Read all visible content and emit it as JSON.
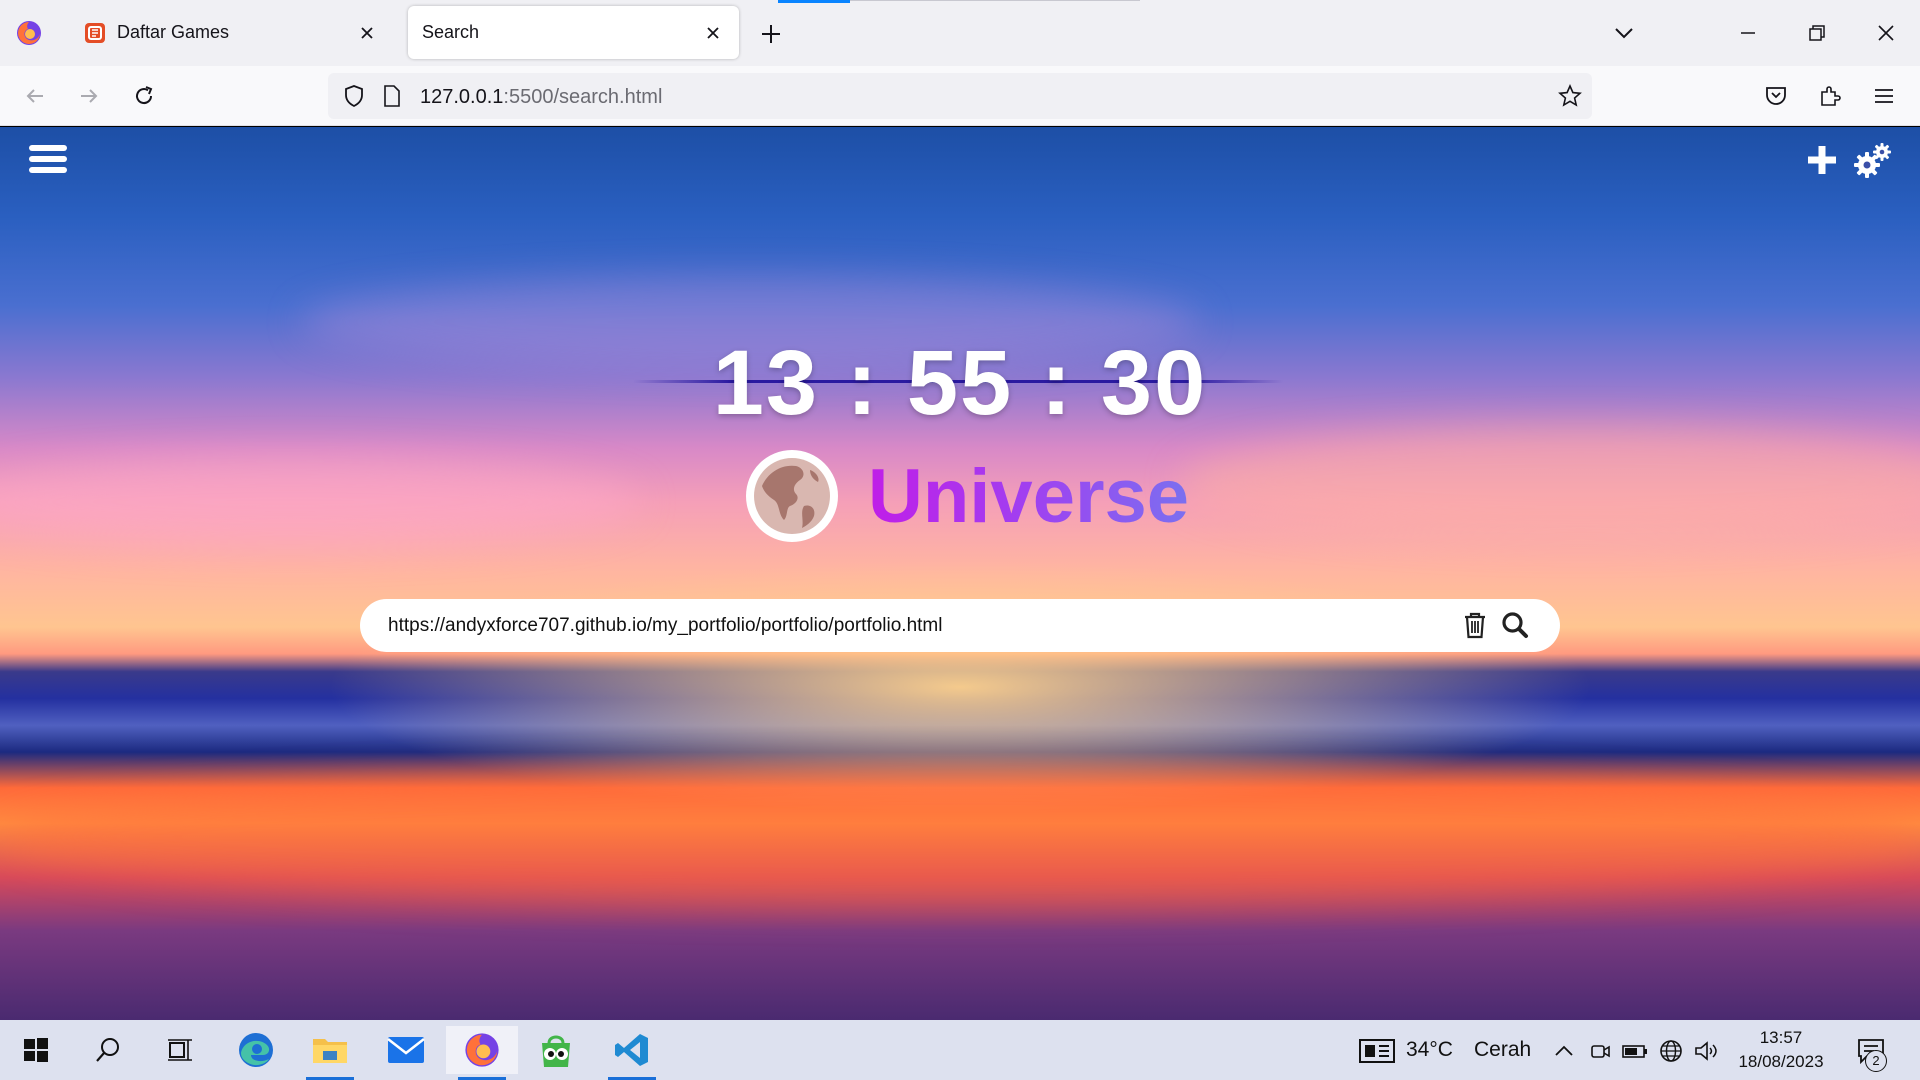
{
  "browser": {
    "tabs": [
      {
        "label": "Daftar Games",
        "favicon": "html5-icon",
        "active": false
      },
      {
        "label": "Search",
        "favicon": "",
        "active": true
      }
    ],
    "url": {
      "host": "127.0.0.1",
      "path": ":5500/search.html"
    }
  },
  "page": {
    "clock": "13 : 55 : 30",
    "brand": "Universe",
    "search_value": "https://andyxforce707.github.io/my_portfolio/portfolio/portfolio.html"
  },
  "taskbar": {
    "apps": [
      "start-icon",
      "search-icon",
      "task-view-icon",
      "edge-icon",
      "file-explorer-icon",
      "mail-icon",
      "firefox-icon",
      "tokopedia-icon",
      "vscode-icon"
    ],
    "weather": {
      "temp": "34°C",
      "condition": "Cerah"
    },
    "time": "13:57",
    "date": "18/08/2023",
    "notification_count": "2"
  },
  "colors": {
    "accent": "#1a6fd8",
    "brand_start": "#c01ee8",
    "brand_end": "#7a70f0"
  }
}
